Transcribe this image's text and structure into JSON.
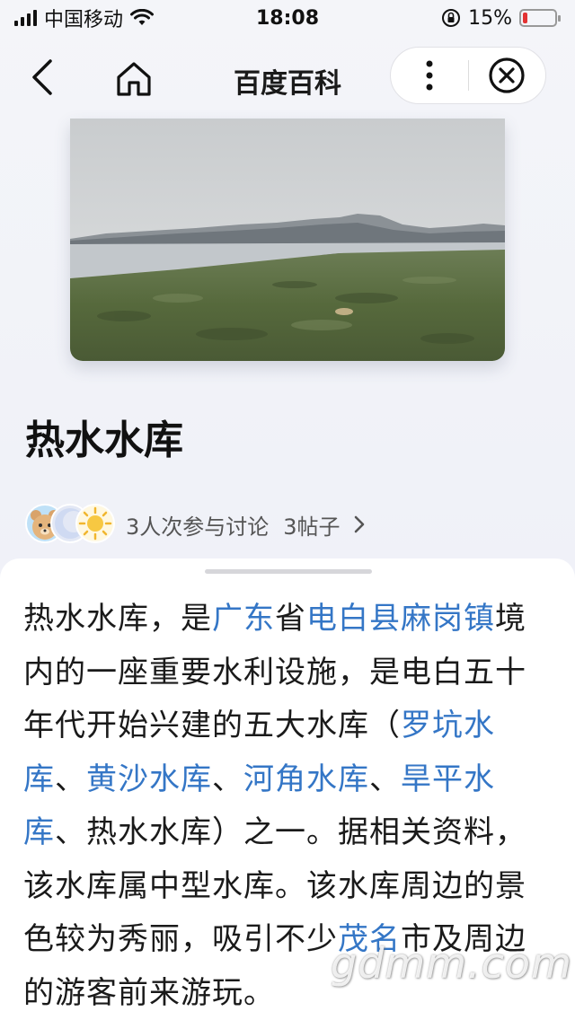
{
  "status": {
    "carrier": "中国移动",
    "time": "18:08",
    "battery_text": "15%",
    "battery_level": 0.15,
    "battery_color": "#e33333"
  },
  "nav": {
    "title": "百度百科",
    "back_icon": "chevron-left",
    "home_icon": "home",
    "more_icon": "vertical-dots",
    "close_icon": "circle-x"
  },
  "entry": {
    "title": "热水水库"
  },
  "discussion": {
    "people_text": "3人次参与讨论",
    "posts_text": "3帖子"
  },
  "content": {
    "segments": [
      {
        "text": "热水水库，是",
        "link": false
      },
      {
        "text": "广东",
        "link": true
      },
      {
        "text": "省",
        "link": false
      },
      {
        "text": "电白县",
        "link": true
      },
      {
        "text": "麻岗镇",
        "link": true
      },
      {
        "text": "境内的一座重要水利设施，是电白五十年代开始兴建的五大水库（",
        "link": false
      },
      {
        "text": "罗坑水库",
        "link": true
      },
      {
        "text": "、",
        "link": false
      },
      {
        "text": "黄沙水库",
        "link": true
      },
      {
        "text": "、",
        "link": false
      },
      {
        "text": "河角水库",
        "link": true
      },
      {
        "text": "、",
        "link": false
      },
      {
        "text": "旱平水库",
        "link": true
      },
      {
        "text": "、热水水库）之一。据相关资料，该水库属中型水库。该水库周边的景色较为秀丽，吸引不少",
        "link": false
      },
      {
        "text": "茂名",
        "link": true
      },
      {
        "text": "市及周边的游客前来游玩。",
        "link": false
      }
    ]
  },
  "watermark": "gdmm.com",
  "colors": {
    "link": "#3476c6",
    "background": "#eef0f7",
    "card": "#ffffff"
  }
}
